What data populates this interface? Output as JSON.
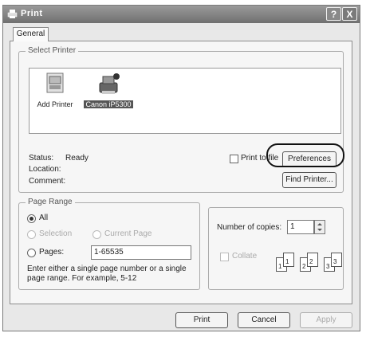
{
  "window": {
    "title": "Print",
    "help_button": "?",
    "close_button": "X"
  },
  "tabs": [
    {
      "label": "General"
    }
  ],
  "select_printer": {
    "legend": "Select Printer",
    "printers": [
      {
        "label": "Add Printer",
        "icon": "add-printer-icon",
        "selected": false
      },
      {
        "label": "Canon iP5300",
        "icon": "printer-icon",
        "selected": true
      }
    ],
    "status_label": "Status:",
    "status_value": "Ready",
    "location_label": "Location:",
    "location_value": "",
    "comment_label": "Comment:",
    "comment_value": "",
    "print_to_file_label": "Print to file",
    "preferences_button": "Preferences",
    "find_printer_button": "Find Printer..."
  },
  "page_range": {
    "legend": "Page Range",
    "all_label": "All",
    "selection_label": "Selection",
    "current_page_label": "Current Page",
    "pages_label": "Pages:",
    "pages_value": "1-65535",
    "help_text_line1": "Enter either a single page number or a single",
    "help_text_line2": "page range.  For example, 5-12"
  },
  "copies": {
    "number_label": "Number of copies:",
    "number_value": "1",
    "collate_label": "Collate",
    "collate_pages": [
      "1",
      "1",
      "2",
      "2",
      "3",
      "3"
    ]
  },
  "footer": {
    "print_button": "Print",
    "cancel_button": "Cancel",
    "apply_button": "Apply"
  }
}
